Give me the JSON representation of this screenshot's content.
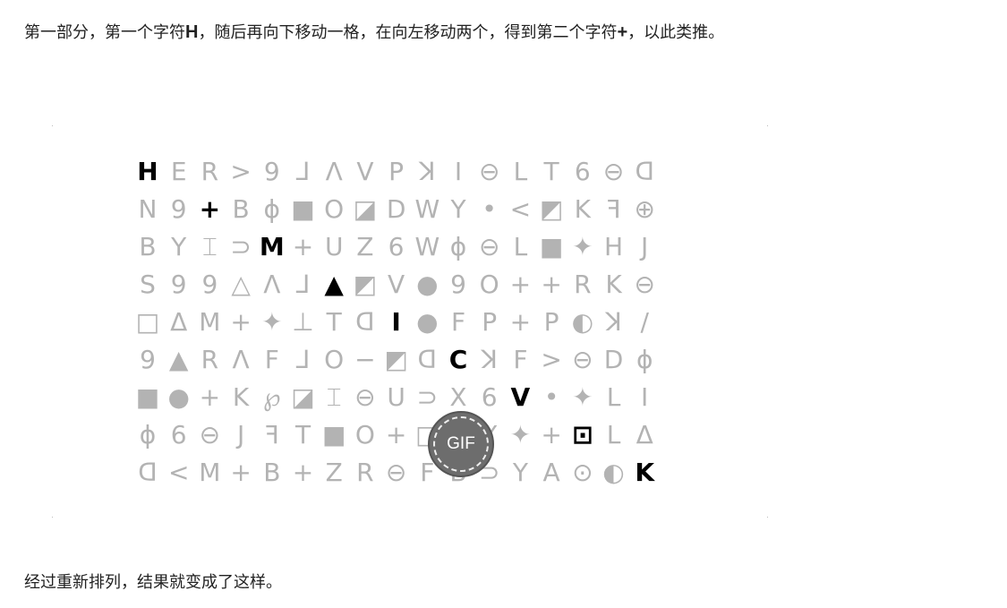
{
  "intro": {
    "before_first": "第一部分，第一个字符",
    "first_char": "H",
    "middle": "，随后再向下移动一格，在向左移动两个，得到第二个字符",
    "second_char": "+",
    "after": "，以此类推。"
  },
  "figure": {
    "badge": "GIF",
    "rows": [
      [
        "H",
        "E",
        "R",
        ">",
        "9",
        "⅃",
        "Λ",
        "V",
        "P",
        "ꓘ",
        "I",
        "⊖",
        "L",
        "T",
        "6",
        "⊖",
        "ᗡ"
      ],
      [
        "N",
        "9",
        "+",
        "B",
        "ɸ",
        "■",
        "O",
        "◪",
        "D",
        "W",
        "Y",
        "•",
        "<",
        "◩",
        "K",
        "ꟻ",
        "⊕"
      ],
      [
        "B",
        "Y",
        "⌶",
        "⊃",
        "M",
        "+",
        "U",
        "Z",
        "6",
        "W",
        "ɸ",
        "⊖",
        "L",
        "■",
        "✦",
        "H",
        "J"
      ],
      [
        "S",
        "9",
        "9",
        "△",
        "Λ",
        "⅃",
        "▲",
        "◩",
        "V",
        "●",
        "9",
        "O",
        "+",
        "+",
        "R",
        "K",
        "⊖"
      ],
      [
        "□",
        "Δ",
        "M",
        "+",
        "✦",
        "⊥",
        "T",
        "ᗡ",
        "I",
        "●",
        "F",
        "P",
        "+",
        "P",
        "◐",
        "ꓘ",
        "/"
      ],
      [
        "9",
        "▲",
        "R",
        "Λ",
        "F",
        "⅃",
        "O",
        "−",
        "◩",
        "ᗡ",
        "C",
        "ꓘ",
        "F",
        ">",
        "⊖",
        "D",
        "ɸ"
      ],
      [
        "■",
        "●",
        "+",
        "K",
        "℘",
        "◪",
        "⌶",
        "⊖",
        "U",
        "⊃",
        "X",
        "6",
        "V",
        "•",
        "✦",
        "L",
        "I"
      ],
      [
        "ɸ",
        "6",
        "⊖",
        "J",
        "ꟻ",
        "T",
        "■",
        "O",
        "+",
        "□",
        "N",
        "Y",
        "✦",
        "+",
        "⊡",
        "L",
        "Δ"
      ],
      [
        "ᗡ",
        "<",
        "M",
        "+",
        "B",
        "+",
        "Z",
        "R",
        "⊖",
        "F",
        "B",
        "⊃",
        "Y",
        "A",
        "⊙",
        "◐",
        "K"
      ]
    ],
    "highlighted": [
      [
        0,
        0
      ],
      [
        1,
        2
      ],
      [
        2,
        4
      ],
      [
        3,
        6
      ],
      [
        4,
        8
      ],
      [
        5,
        10
      ],
      [
        6,
        12
      ],
      [
        7,
        14
      ],
      [
        8,
        16
      ]
    ],
    "colors": {
      "dim": "#b3b3b3",
      "highlight": "#000000"
    }
  },
  "outro": "经过重新排列，结果就变成了这样。"
}
